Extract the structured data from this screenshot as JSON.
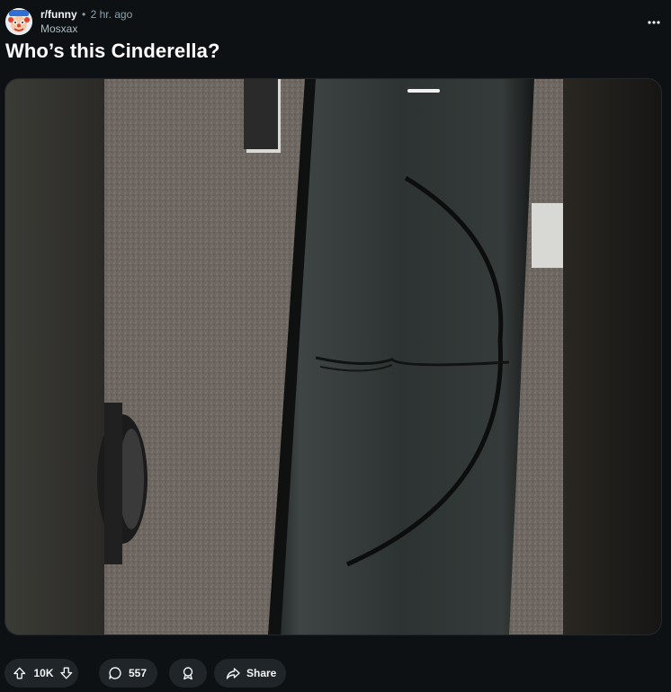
{
  "post": {
    "subreddit": "r/funny",
    "separator": "•",
    "time_ago": "2 hr. ago",
    "author": "Mosxax",
    "title": "Who’s this Cinderella?"
  },
  "actions": {
    "vote_count": "10K",
    "comment_count": "557",
    "share_label": "Share"
  },
  "icons": {
    "more": "more-horizontal-icon",
    "upvote": "upvote-arrow-icon",
    "downvote": "downvote-arrow-icon",
    "comment": "comment-bubble-icon",
    "award": "award-icon",
    "share": "share-arrow-icon"
  },
  "colors": {
    "background": "#0e1113",
    "pill": "#1f2529",
    "text": "#f2f4f5",
    "meta": "#8ba2ad"
  }
}
